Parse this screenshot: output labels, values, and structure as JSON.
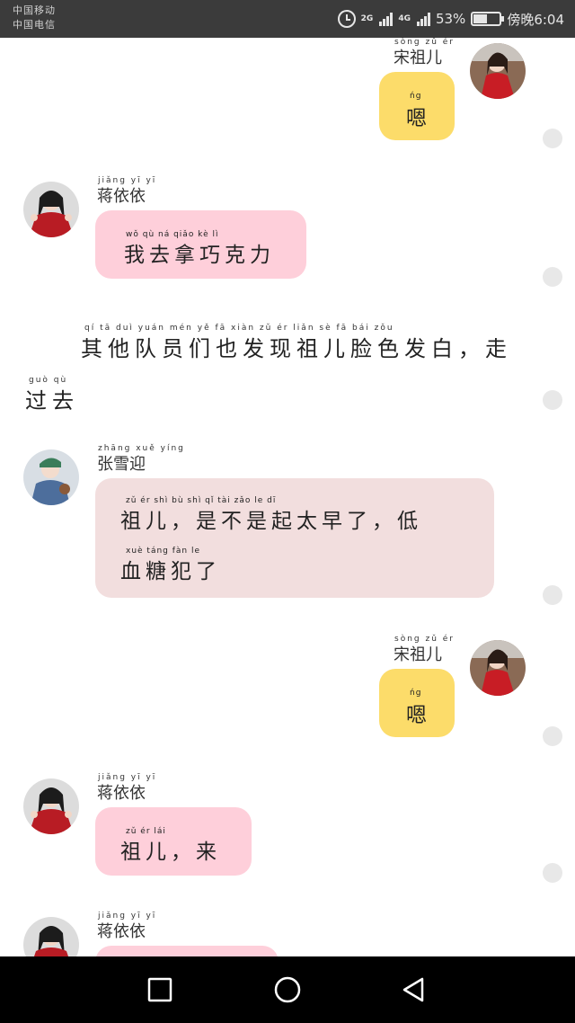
{
  "status_bar": {
    "carrier_1": "中国移动",
    "carrier_2": "中国电信",
    "network_2g": "2G",
    "network_4g": "4G",
    "battery": "53%",
    "battery_level": 0.53,
    "time": "傍晚6:04",
    "icons": [
      "alarm-icon",
      "signal-icon",
      "battery-icon"
    ]
  },
  "messages": [
    {
      "side": "right",
      "name": "宋祖儿",
      "name_pinyin": "sòng zǔ ér",
      "text_lines": [
        "嗯"
      ],
      "pinyin_lines": [
        "ńg"
      ],
      "color": "#fcdc6a"
    },
    {
      "side": "left",
      "name": "蒋依依",
      "name_pinyin": "jiǎng yī yī",
      "text_lines": [
        "我去拿巧克力"
      ],
      "pinyin_lines": [
        "wǒ qù ná qiǎo kè lì"
      ],
      "color": "#fecfda"
    },
    {
      "side": "left",
      "name": "张雪迎",
      "name_pinyin": "zhāng xuě yíng",
      "text_lines": [
        "祖儿，是不是起太早了，低",
        "血糖犯了"
      ],
      "pinyin_lines": [
        "zǔ ér   shì bù shì qǐ tài zǎo le   dī",
        "xuè táng fàn le"
      ],
      "color": "#f2dede"
    },
    {
      "side": "right",
      "name": "宋祖儿",
      "name_pinyin": "sòng zǔ ér",
      "text_lines": [
        "嗯"
      ],
      "pinyin_lines": [
        "ńg"
      ],
      "color": "#fcdc6a"
    },
    {
      "side": "left",
      "name": "蒋依依",
      "name_pinyin": "jiǎng yī yī",
      "text_lines": [
        "祖儿，来"
      ],
      "pinyin_lines": [
        "zǔ ér   lái"
      ],
      "color": "#fecfda"
    },
    {
      "side": "left",
      "name": "蒋依依",
      "name_pinyin": "jiǎng yī yī",
      "text_lines": [],
      "pinyin_lines": [],
      "color": "#fecfda"
    }
  ],
  "narration": {
    "line_1": "其他队员们也发现祖儿脸色发白，走",
    "line_1_pinyin": "qí tā duì yuán mén yě fā xiàn zǔ ér liǎn sè fā bái  zǒu",
    "line_2": "过去",
    "line_2_pinyin": "guò qù"
  },
  "nav": {
    "icons": [
      "recent-apps-icon",
      "home-icon",
      "back-icon"
    ]
  }
}
